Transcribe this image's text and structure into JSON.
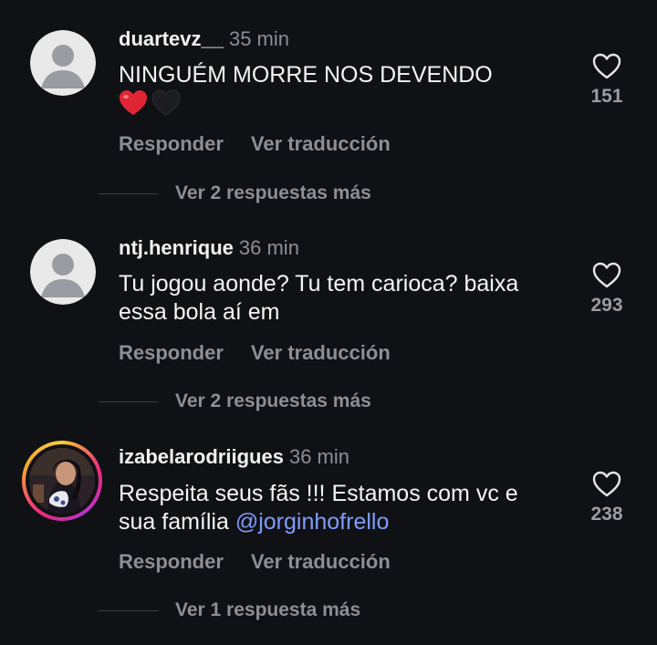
{
  "comments": [
    {
      "username": "duartevz__",
      "time": "35 min",
      "text": "NINGUÉM MORRE NOS DEVENDO",
      "emojis": [
        "red-heart",
        "black-heart"
      ],
      "likes": "151",
      "reply_label": "Responder",
      "translate_label": "Ver traducción",
      "more_replies": "Ver 2 respuestas más"
    },
    {
      "username": "ntj.henrique",
      "time": "36 min",
      "text": "Tu jogou aonde? Tu tem carioca? baixa essa bola aí em",
      "likes": "293",
      "reply_label": "Responder",
      "translate_label": "Ver traducción",
      "more_replies": "Ver 2 respuestas más"
    },
    {
      "username": "izabelarodriigues",
      "time": "36 min",
      "text": "Respeita seus fãs !!! Estamos com vc e sua família ",
      "mention": "@jorginhofrello",
      "likes": "238",
      "reply_label": "Responder",
      "translate_label": "Ver traducción",
      "more_replies": "Ver 1 respuesta más"
    }
  ],
  "colors": {
    "background": "#101114",
    "primary_text": "#f5f5f5",
    "secondary_text": "#8c8f96",
    "mention": "#7f9cff"
  }
}
